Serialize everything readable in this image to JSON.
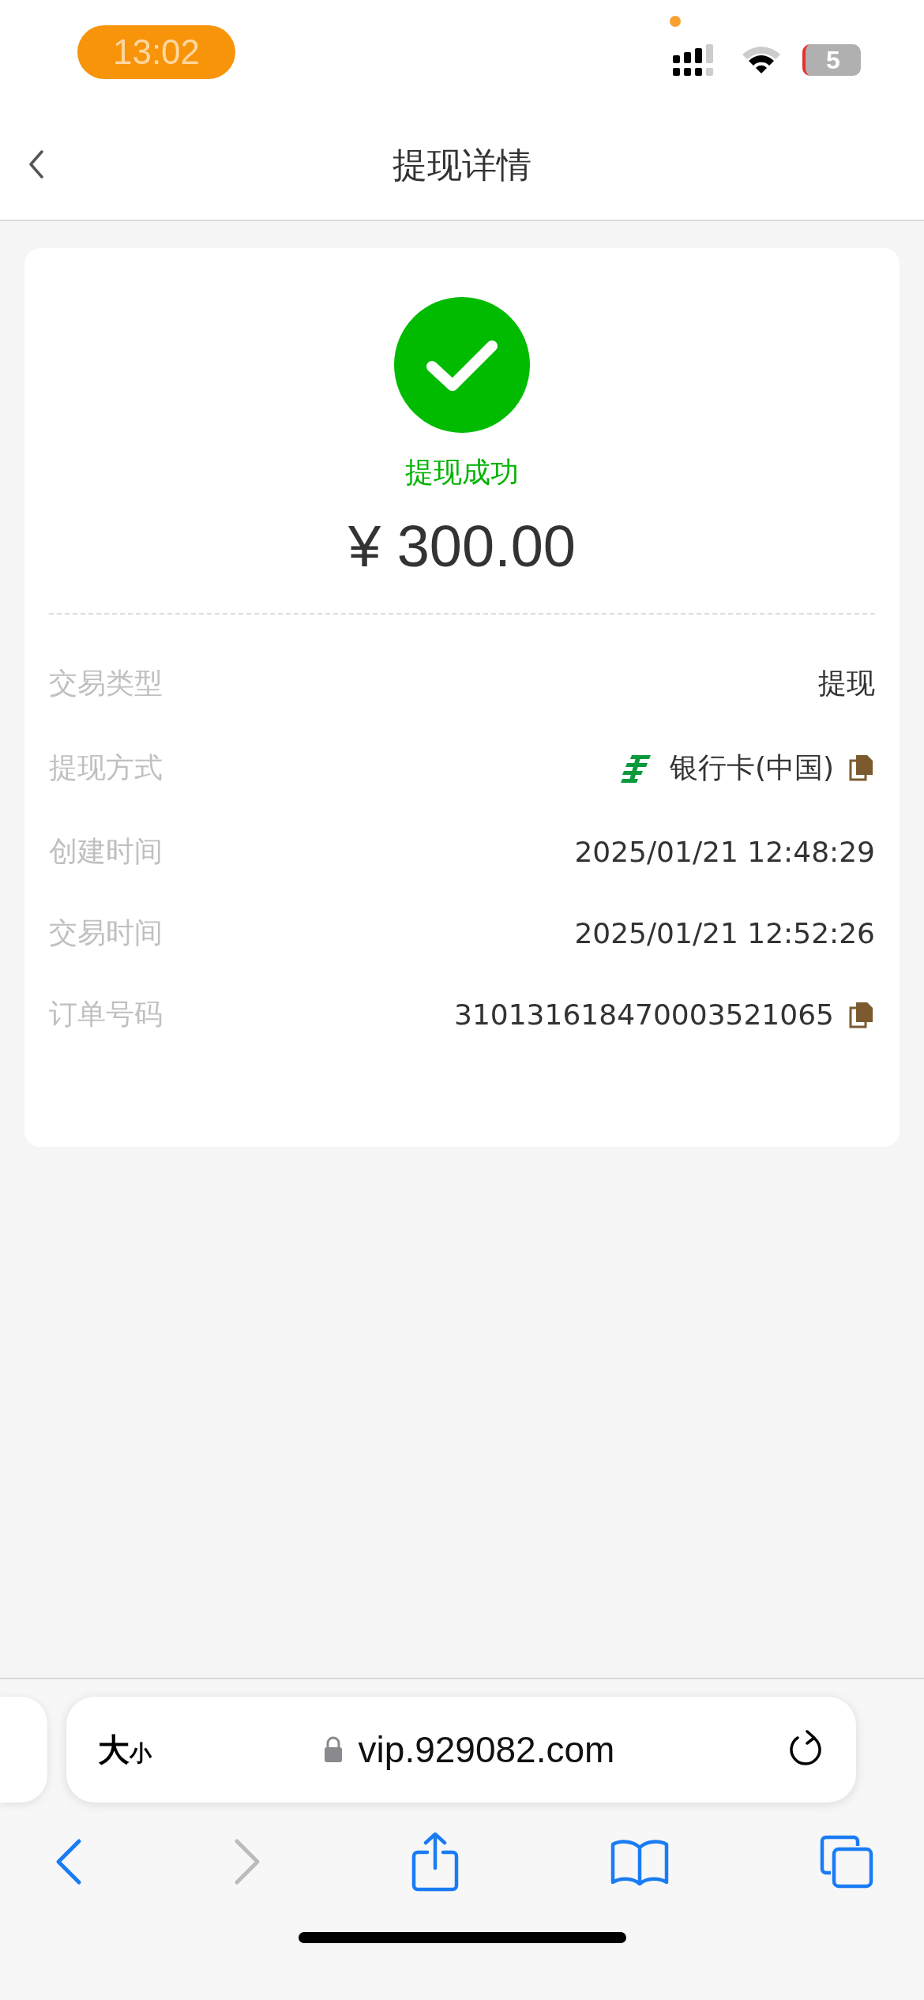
{
  "status_bar": {
    "time": "13:02",
    "battery": "5"
  },
  "nav": {
    "title": "提现详情"
  },
  "result": {
    "success": true,
    "status": "提现成功",
    "amount": "¥ 300.00"
  },
  "details": [
    {
      "label": "交易类型",
      "value": "提现",
      "kind": "plain"
    },
    {
      "label": "提现方式",
      "value": "银行卡(中国)",
      "kind": "bank"
    },
    {
      "label": "创建时间",
      "value": "2025/01/21 12:48:29",
      "kind": "plain"
    },
    {
      "label": "交易时间",
      "value": "2025/01/21 12:52:26",
      "kind": "plain"
    },
    {
      "label": "订单号码",
      "value": "310131618470003521065",
      "kind": "copy"
    }
  ],
  "browser": {
    "text_size": [
      "大",
      "小"
    ],
    "url": "vip.929082.com",
    "back_enabled": true,
    "forward_enabled": false
  }
}
